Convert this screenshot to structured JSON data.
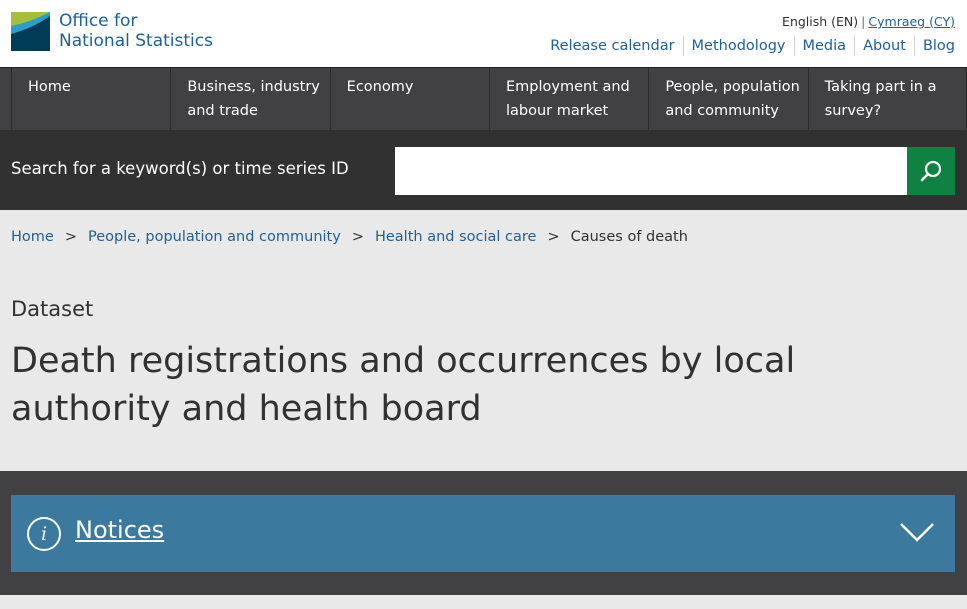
{
  "header": {
    "logo_line1": "Office for",
    "logo_line2": "National Statistics",
    "lang_en": "English (EN)",
    "lang_sep": "|",
    "lang_cy": "Cymraeg (CY)",
    "links": [
      "Release calendar",
      "Methodology",
      "Media",
      "About",
      "Blog"
    ]
  },
  "nav": {
    "items": [
      {
        "label": "Home"
      },
      {
        "label": "Business, industry and trade"
      },
      {
        "label": "Economy"
      },
      {
        "label": "Employment and labour market"
      },
      {
        "label": "People, population and community"
      },
      {
        "label": "Taking part in a survey?"
      }
    ]
  },
  "search": {
    "label": "Search for a keyword(s) or time series ID",
    "value": ""
  },
  "breadcrumb": {
    "items": [
      "Home",
      "People, population and community",
      "Health and social care"
    ],
    "current": "Causes of death",
    "separator": ">"
  },
  "page": {
    "type": "Dataset",
    "title": "Death registrations and occurrences by local authority and health board"
  },
  "notices": {
    "label": "Notices",
    "icon": "i"
  },
  "colors": {
    "brand": "#206095",
    "nav_bg": "#414042",
    "search_bg": "#323132",
    "search_button": "#0f8243",
    "notices_bg": "#3b7a9e"
  }
}
